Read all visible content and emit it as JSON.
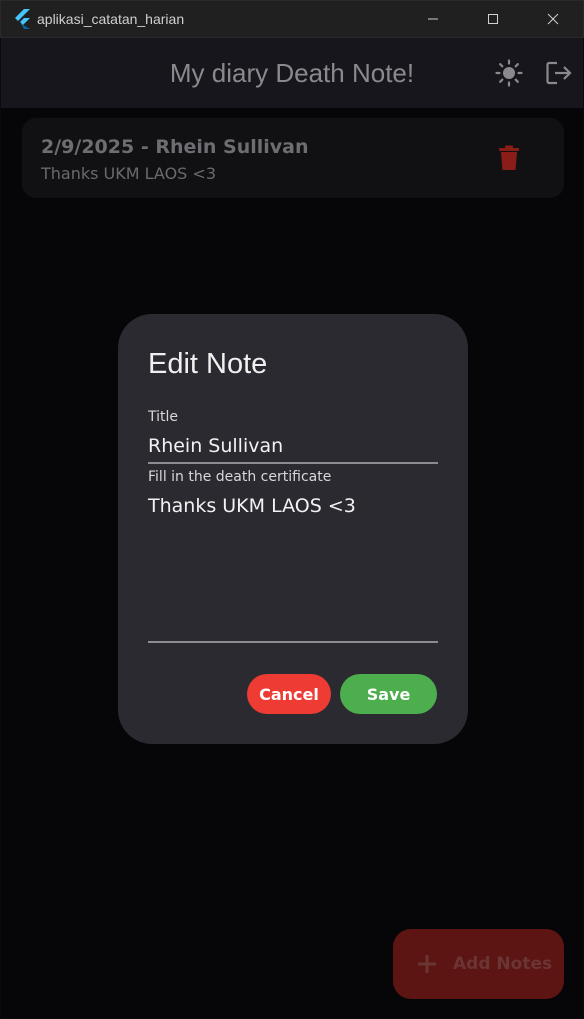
{
  "window": {
    "title": "aplikasi_catatan_harian",
    "controls": [
      "minimize-icon",
      "maximize-icon",
      "close-icon"
    ]
  },
  "appbar": {
    "title": "My diary Death Note!",
    "icons": [
      "sun-icon",
      "logout-icon"
    ]
  },
  "notes": [
    {
      "heading": "2/9/2025 - Rhein Sullivan",
      "body": "Thanks UKM LAOS <3",
      "delete_icon": "trash-icon"
    }
  ],
  "dialog": {
    "title": "Edit Note",
    "title_field_label": "Title",
    "title_field_value": "Rhein Sullivan",
    "content_field_label": "Fill in the death certificate",
    "content_field_value": "Thanks UKM LAOS <3",
    "cancel_label": "Cancel",
    "save_label": "Save"
  },
  "fab": {
    "label": "Add Notes",
    "icon": "plus-icon"
  },
  "colors": {
    "cancel": "#ee3b34",
    "save": "#4cae4c",
    "delete": "#c0261e",
    "fab": "#5c1512"
  }
}
